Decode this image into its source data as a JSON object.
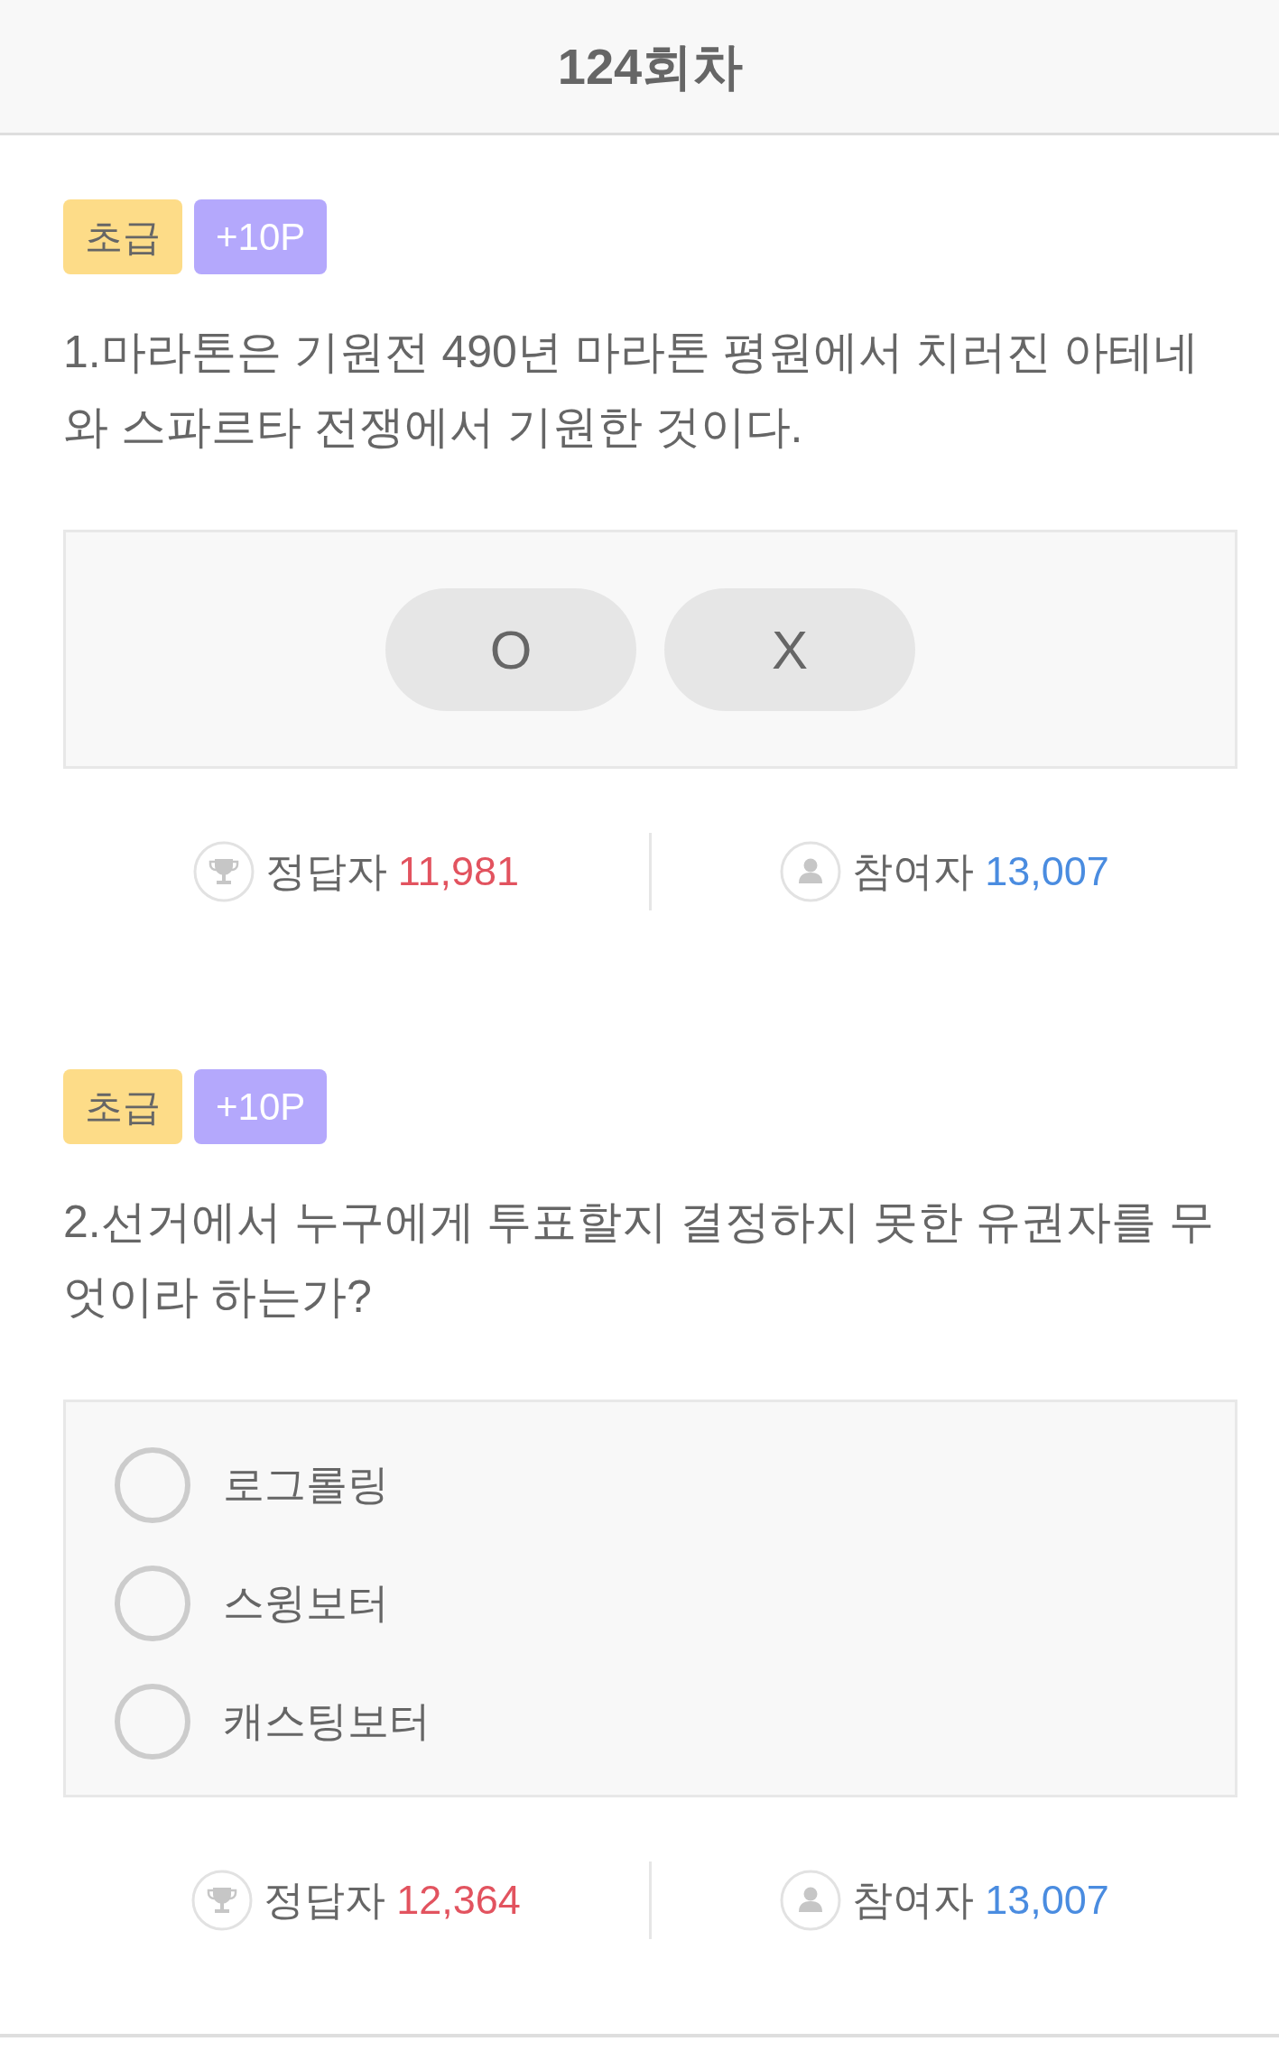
{
  "header": {
    "title": "124회차"
  },
  "questions": [
    {
      "kind": "ox",
      "tags": [
        {
          "kind": "difficulty",
          "label": "초급"
        },
        {
          "kind": "reward",
          "label": "+10P"
        }
      ],
      "text": "1.마라톤은 기원전 490년 마라톤 평원에서 치러진 아테네와 스파르타 전쟁에서 기원한 것이다.",
      "options": [
        {
          "label": "O",
          "selected": false
        },
        {
          "label": "X",
          "selected": false
        }
      ],
      "stats": [
        {
          "kind": "correct",
          "label": "정답자",
          "value": "11,981"
        },
        {
          "kind": "participants",
          "label": "참여자",
          "value": "13,007"
        }
      ]
    },
    {
      "kind": "choice",
      "tags": [
        {
          "kind": "difficulty",
          "label": "초급"
        },
        {
          "kind": "reward",
          "label": "+10P"
        }
      ],
      "text": "2.선거에서 누구에게 투표할지 결정하지 못한 유권자를 무엇이라 하는가?",
      "options": [
        {
          "label": "로그롤링",
          "selected": false
        },
        {
          "label": "스윙보터",
          "selected": false
        },
        {
          "label": "캐스팅보터",
          "selected": false
        }
      ],
      "stats": [
        {
          "kind": "correct",
          "label": "정답자",
          "value": "12,364"
        },
        {
          "kind": "participants",
          "label": "참여자",
          "value": "13,007"
        }
      ]
    }
  ]
}
